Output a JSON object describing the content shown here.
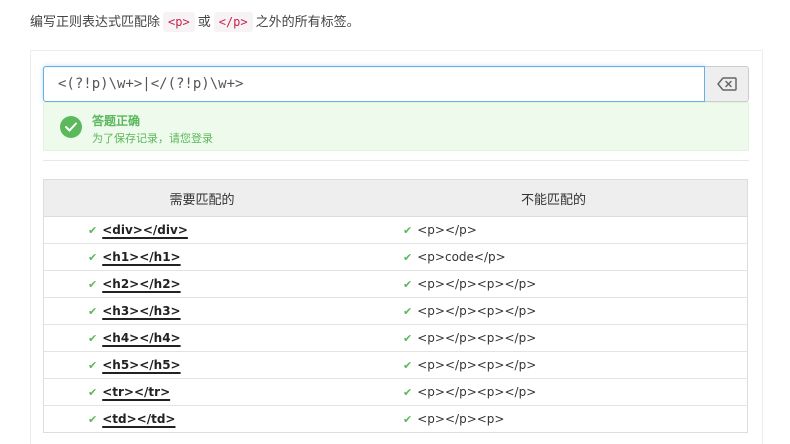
{
  "instruction": {
    "prefix": "编写正则表达式匹配除",
    "code1": "<p>",
    "conj": "或",
    "code2": "</p>",
    "suffix": "之外的所有标签。"
  },
  "regex_input": {
    "value": "<(?!p)\\w+>|</(?!p)\\w+>"
  },
  "clear_button": {
    "icon": "backspace-icon"
  },
  "result": {
    "status": "success",
    "title": "答题正确",
    "subtitle": "为了保存记录，请您登录",
    "color": "#5cb85c"
  },
  "table": {
    "headers": [
      "需要匹配的",
      "不能匹配的"
    ],
    "rows": [
      {
        "match": "<div></div>",
        "nomatch": "<p></p>"
      },
      {
        "match": "<h1></h1>",
        "nomatch": "<p>code</p>"
      },
      {
        "match": "<h2></h2>",
        "nomatch": "<p></p><p></p>"
      },
      {
        "match": "<h3></h3>",
        "nomatch": "<p></p><p></p>"
      },
      {
        "match": "<h4></h4>",
        "nomatch": "<p></p><p></p>"
      },
      {
        "match": "<h5></h5>",
        "nomatch": "<p></p><p></p>"
      },
      {
        "match": "<tr></tr>",
        "nomatch": "<p></p><p></p>"
      },
      {
        "match": "<td></td>",
        "nomatch": "<p></p><p>"
      }
    ]
  }
}
